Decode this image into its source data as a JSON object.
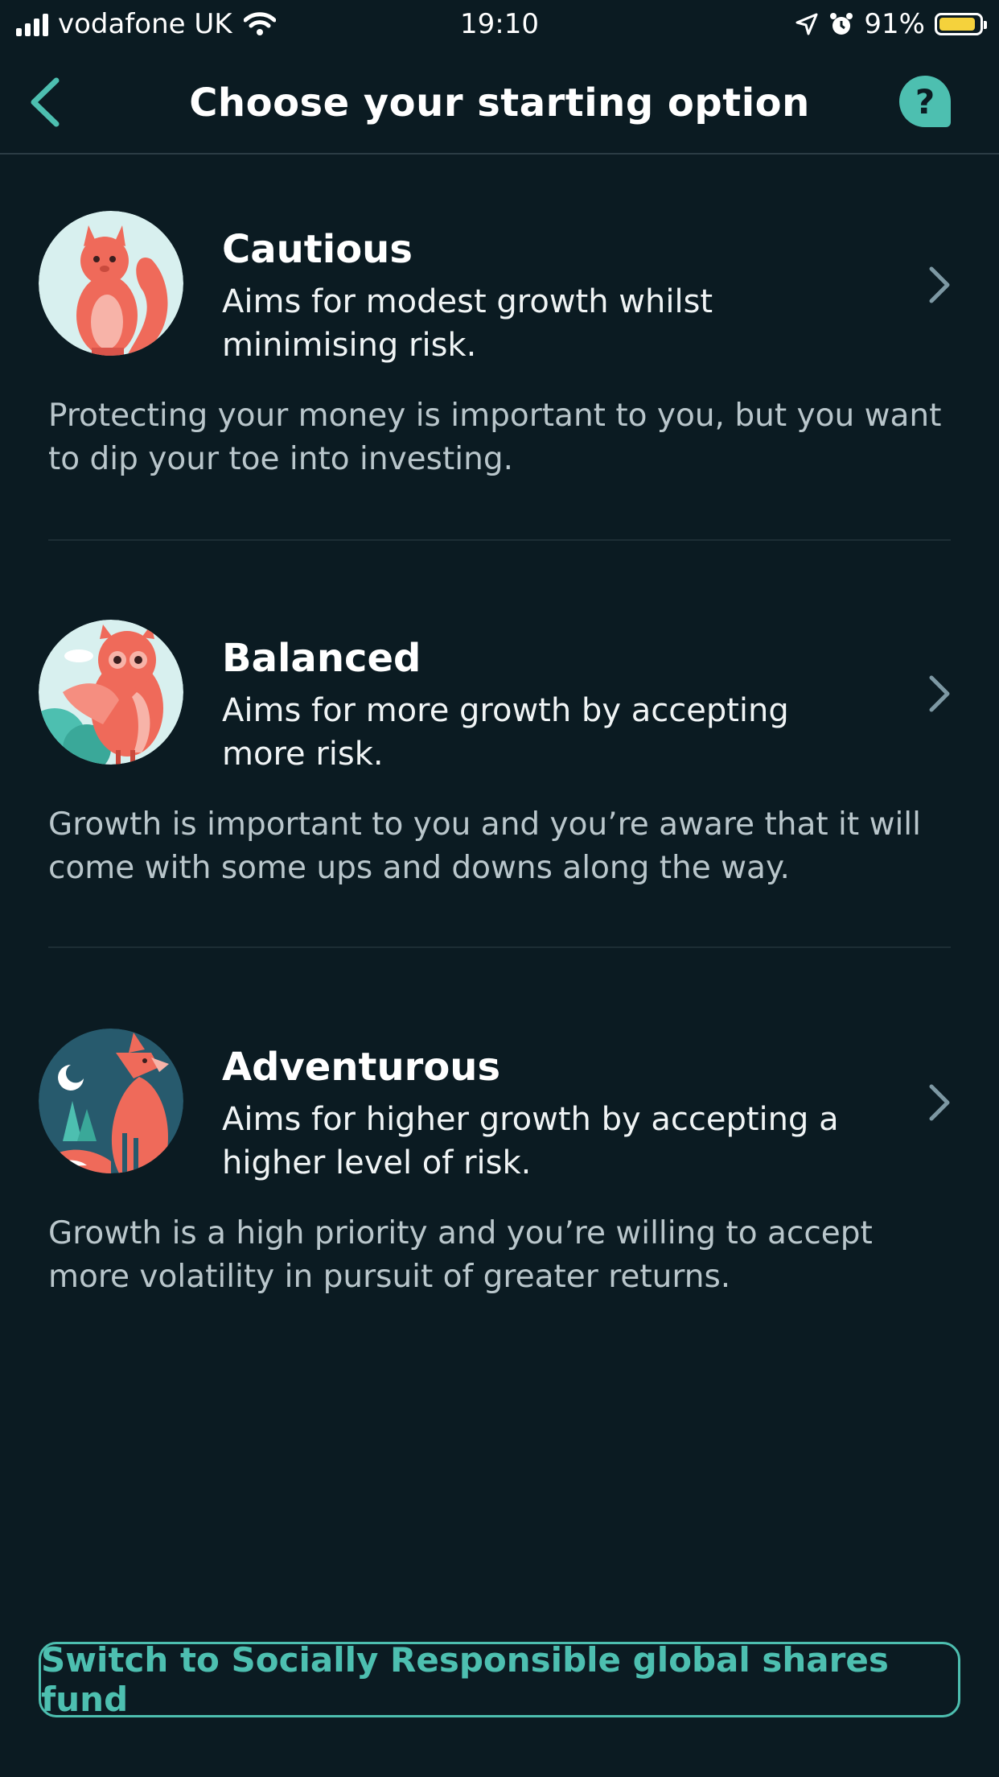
{
  "status_bar": {
    "carrier": "vodafone UK",
    "time": "19:10",
    "battery": "91%",
    "battery_level": 0.91,
    "icons": [
      "signal-icon",
      "wifi-icon",
      "location-icon",
      "alarm-icon",
      "battery-icon"
    ]
  },
  "header": {
    "title": "Choose your starting option",
    "help_label": "?"
  },
  "options": [
    {
      "name": "Cautious",
      "subtitle": "Aims for modest growth whilst minimising risk.",
      "description": "Protecting your money is important to you, but you want to dip your toe into investing.",
      "illustration": "squirrel"
    },
    {
      "name": "Balanced",
      "subtitle": "Aims for more growth by accepting more risk.",
      "description": "Growth is important to you and you’re aware that it will come with some ups and downs along the way.",
      "illustration": "owl"
    },
    {
      "name": "Adventurous",
      "subtitle": "Aims for higher growth by accepting a higher level of risk.",
      "description": "Growth is a high priority and you’re willing to accept more volatility in pursuit of greater returns.",
      "illustration": "fox"
    }
  ],
  "footer": {
    "switch_label": "Switch to Socially Responsible global shares fund"
  },
  "colors": {
    "background": "#0b1b22",
    "accent": "#4dbfb0",
    "illustration": "#ef6a5a"
  }
}
